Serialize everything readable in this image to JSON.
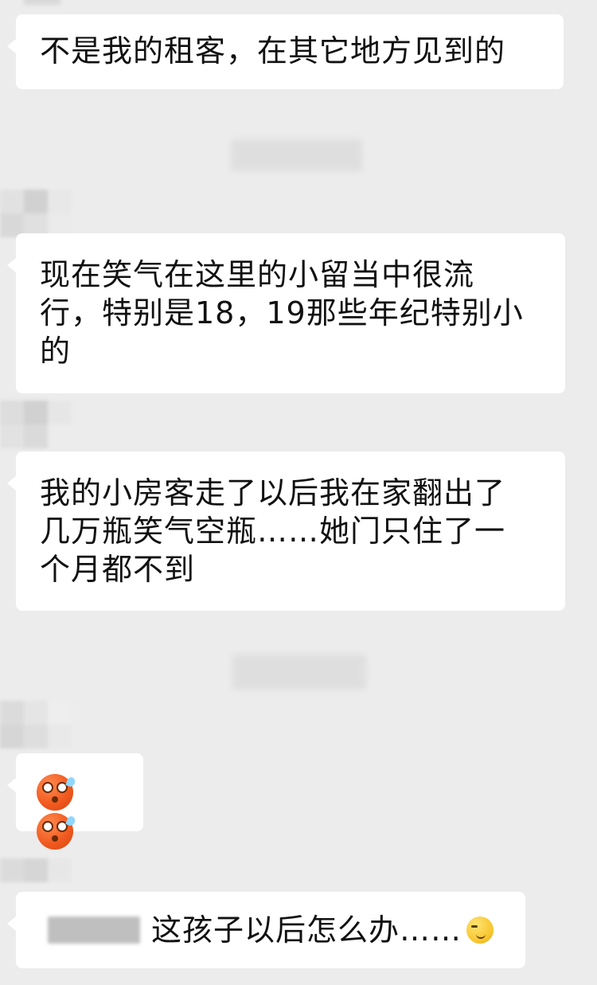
{
  "messages": [
    {
      "text": "不是我的租客，在其它地方见到的"
    },
    {
      "text": "现在笑气在这里的小留当中很流\n行，特别是18，19那些年纪特别小\n的"
    },
    {
      "text": "我的小房客走了以后我在家翻出了\n几万瓶笑气空瓶……她门只住了一\n个月都不到"
    },
    {
      "emojis": [
        "flushed-face",
        "flushed-face"
      ]
    },
    {
      "text": "这孩子以后怎么办……",
      "emoji": "smirking-face"
    }
  ]
}
